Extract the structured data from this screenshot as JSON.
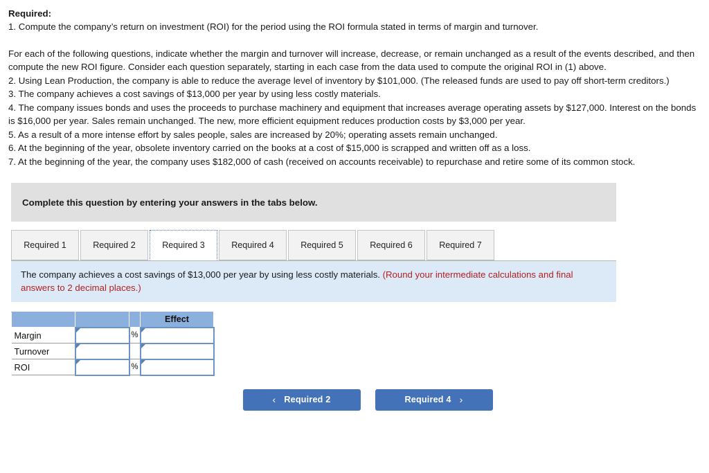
{
  "requirements": {
    "heading": "Required:",
    "item1": "1. Compute the company’s return on investment (ROI) for the period using the ROI formula stated in terms of margin and turnover.",
    "intro": "For each of the following questions, indicate whether the margin and turnover will increase, decrease, or remain unchanged as a result of the events described, and then compute the new ROI figure. Consider each question separately, starting in each case from the data used to compute the original ROI in (1) above.",
    "item2": "2. Using Lean Production, the company is able to reduce the average level of inventory by $101,000. (The released funds are used to pay off short-term creditors.)",
    "item3": "3. The company achieves a cost savings of $13,000 per year by using less costly materials.",
    "item4": "4. The company issues bonds and uses the proceeds to purchase machinery and equipment that increases average operating assets by $127,000. Interest on the bonds is $16,000 per year. Sales remain unchanged. The new, more efficient equipment reduces production costs by $3,000 per year.",
    "item5": "5. As a result of a more intense effort by sales people, sales are increased by 20%; operating assets remain unchanged.",
    "item6": "6. At the beginning of the year, obsolete inventory carried on the books at a cost of $15,000 is scrapped and written off as a loss.",
    "item7": "7. At the beginning of the year, the company uses $182,000 of cash (received on accounts receivable) to repurchase and retire some of its common stock."
  },
  "banner": {
    "text": "Complete this question by entering your answers in the tabs below."
  },
  "tabs": [
    {
      "label": "Required 1",
      "active": false
    },
    {
      "label": "Required 2",
      "active": false
    },
    {
      "label": "Required 3",
      "active": true
    },
    {
      "label": "Required 4",
      "active": false
    },
    {
      "label": "Required 5",
      "active": false
    },
    {
      "label": "Required 6",
      "active": false
    },
    {
      "label": "Required 7",
      "active": false
    }
  ],
  "infobar": {
    "statement": "The company achieves a cost savings of $13,000 per year by using less costly materials.",
    "hint": "(Round your intermediate calculations and final answers to 2 decimal places.)"
  },
  "answer_table": {
    "headers": [
      "",
      "",
      "",
      "Effect"
    ],
    "rows": [
      {
        "label": "Margin",
        "value": "",
        "unit": "%",
        "effect": ""
      },
      {
        "label": "Turnover",
        "value": "",
        "unit": "",
        "effect": ""
      },
      {
        "label": "ROI",
        "value": "",
        "unit": "%",
        "effect": ""
      }
    ]
  },
  "navigation": {
    "prev_label": "Required 2",
    "next_label": "Required 4",
    "prev_chevron": "‹",
    "next_chevron": "›"
  },
  "colors": {
    "banner_gray": "#e0e0e0",
    "info_blue": "#dce9f7",
    "hint_red": "#b32020",
    "table_header_blue": "#8cb0dd",
    "input_border_blue": "#6b94c4",
    "button_blue": "#4472b8"
  }
}
